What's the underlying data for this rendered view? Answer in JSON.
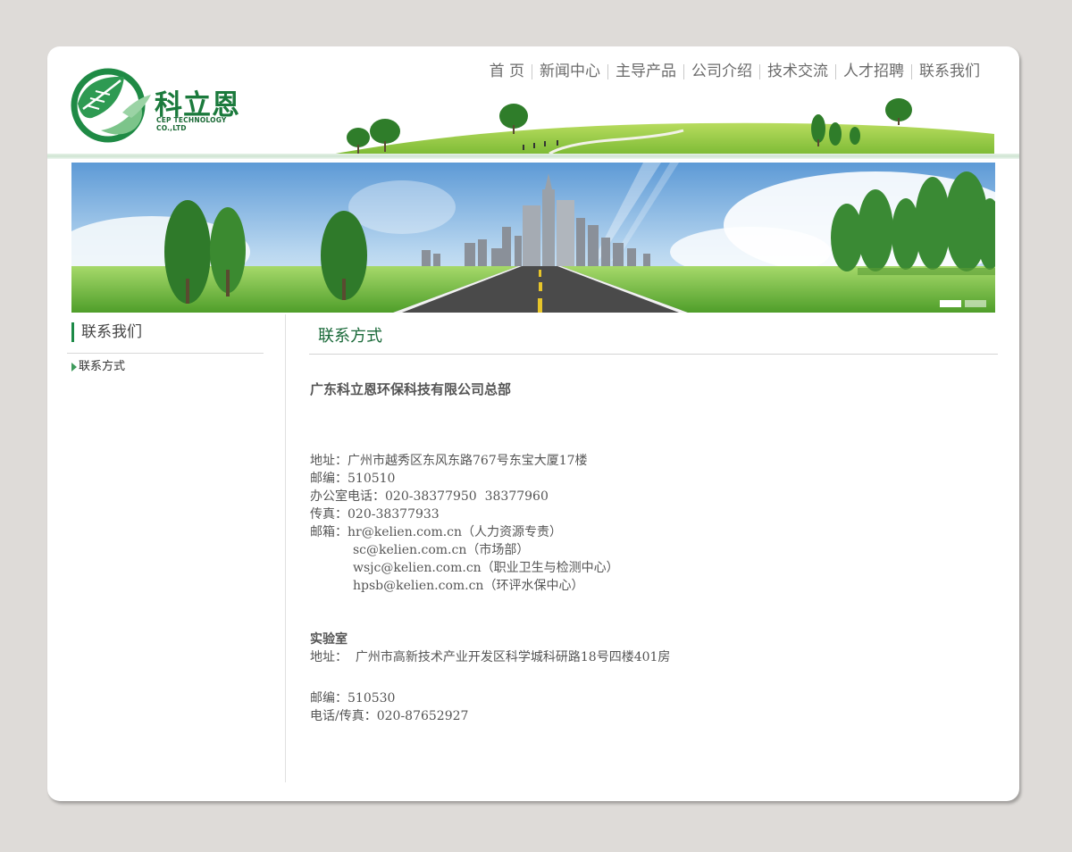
{
  "header": {
    "brand_cn": "科立恩",
    "brand_en": "CEP TECHNOLOGY CO.,LTD",
    "nav": [
      "首 页",
      "新闻中心",
      "主导产品",
      "公司介绍",
      "技术交流",
      "人才招聘",
      "联系我们"
    ]
  },
  "sidebar": {
    "title": "联系我们",
    "items": [
      {
        "label": "联系方式"
      }
    ]
  },
  "main": {
    "title": "联系方式",
    "company": "广东科立恩环保科技有限公司总部",
    "hq": {
      "address": "地址：广州市越秀区东风东路767号东宝大厦17楼",
      "postcode": "邮编：510510",
      "phone": "办公室电话：020-38377950  38377960",
      "fax": "传真：020-38377933",
      "email_label": "邮箱：",
      "emails": [
        "hr@kelien.com.cn（人力资源专责）",
        "sc@kelien.com.cn（市场部）",
        "wsjc@kelien.com.cn（职业卫生与检测中心）",
        "hpsb@kelien.com.cn（环评水保中心）"
      ]
    },
    "lab": {
      "title": "实验室",
      "address": "地址：  广州市高新技术产业开发区科学城科研路18号四楼401房",
      "postcode": "邮编：510530",
      "phone_fax": "电话/传真：020-87652927"
    }
  },
  "colors": {
    "brand_green": "#1b7a3c",
    "nav_text": "#6b6b6b",
    "page_bg": "#dedbd8"
  }
}
